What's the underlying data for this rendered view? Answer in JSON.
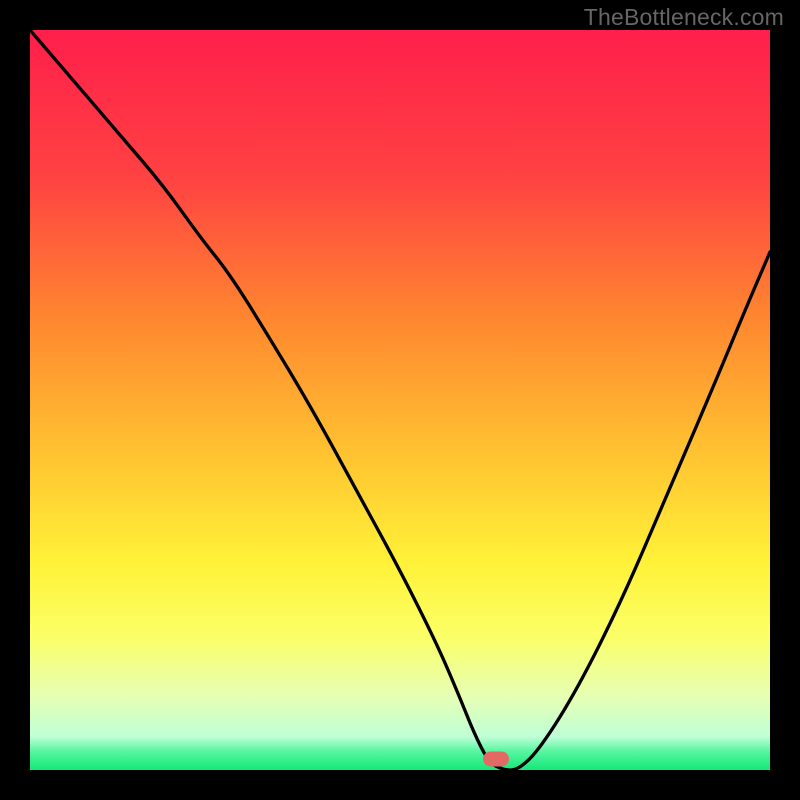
{
  "watermark": "TheBottleneck.com",
  "gradient": {
    "stops": [
      {
        "offset": 0.0,
        "color": "#ff1f4b"
      },
      {
        "offset": 0.2,
        "color": "#ff4242"
      },
      {
        "offset": 0.4,
        "color": "#ff8a2f"
      },
      {
        "offset": 0.58,
        "color": "#ffc531"
      },
      {
        "offset": 0.72,
        "color": "#fff238"
      },
      {
        "offset": 0.82,
        "color": "#fbff67"
      },
      {
        "offset": 0.9,
        "color": "#e6ffb3"
      },
      {
        "offset": 0.955,
        "color": "#bfffd6"
      },
      {
        "offset": 0.975,
        "color": "#56f59f"
      },
      {
        "offset": 1.0,
        "color": "#14e878"
      }
    ]
  },
  "marker": {
    "x_pct": 63.0,
    "y_pct": 98.5,
    "color": "#e36a64"
  },
  "chart_data": {
    "type": "line",
    "title": "",
    "xlabel": "",
    "ylabel": "",
    "xlim": [
      0,
      100
    ],
    "ylim": [
      0,
      100
    ],
    "legend": false,
    "series": [
      {
        "name": "bottleneck-curve",
        "x": [
          0,
          6,
          12,
          18,
          23,
          27,
          32,
          38,
          44,
          50,
          55,
          58,
          60,
          62,
          64,
          66,
          69,
          74,
          80,
          86,
          92,
          97,
          100
        ],
        "y": [
          100,
          93,
          86,
          79,
          72,
          67,
          59,
          49,
          38,
          27,
          17,
          10,
          5,
          1,
          0,
          0,
          3,
          11,
          23,
          37,
          51,
          63,
          70
        ]
      }
    ],
    "optimal_marker": {
      "x": 63,
      "y": 0
    }
  }
}
